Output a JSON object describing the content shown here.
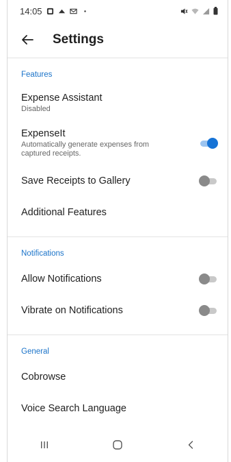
{
  "status_bar": {
    "time": "14:05",
    "left_icons": [
      "notification-icon",
      "cloud-icon",
      "mail-icon",
      "dot-icon"
    ],
    "right_icons": [
      "mute-icon",
      "wifi-icon",
      "signal-icon",
      "battery-icon"
    ]
  },
  "app_bar": {
    "title": "Settings"
  },
  "sections": {
    "features": {
      "header": "Features",
      "expense_assistant": {
        "title": "Expense Assistant",
        "subtitle": "Disabled"
      },
      "expenseit": {
        "title": "ExpenseIt",
        "subtitle": "Automatically generate expenses from captured receipts.",
        "enabled": true
      },
      "save_receipts": {
        "title": "Save Receipts to Gallery",
        "enabled": false
      },
      "additional": {
        "title": "Additional Features"
      }
    },
    "notifications": {
      "header": "Notifications",
      "allow": {
        "title": "Allow Notifications",
        "enabled": false
      },
      "vibrate": {
        "title": "Vibrate on Notifications",
        "enabled": false
      }
    },
    "general": {
      "header": "General",
      "cobrowse": {
        "title": "Cobrowse"
      },
      "voice_search": {
        "title": "Voice Search Language"
      }
    }
  },
  "colors": {
    "accent": "#1673d6",
    "section_header": "#1a73c9",
    "toggle_off": "#8a8a8a"
  }
}
